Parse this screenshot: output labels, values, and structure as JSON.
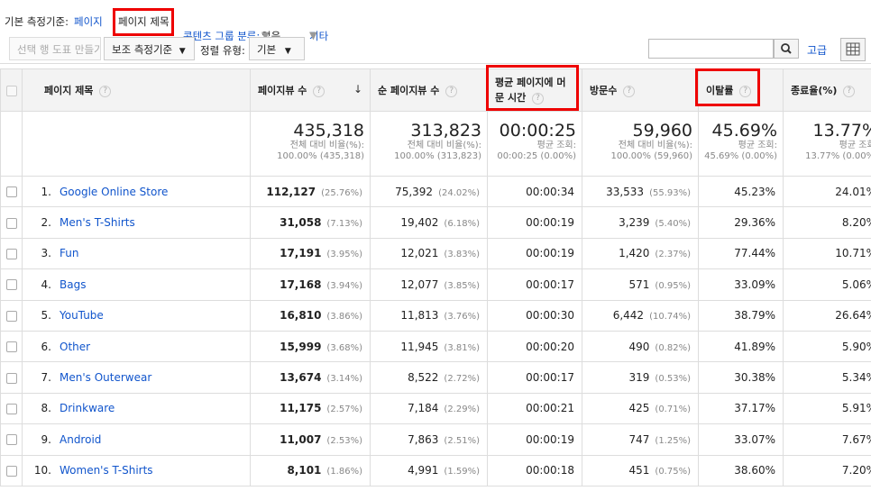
{
  "dimension_bar": {
    "label": "기본 측정기준:",
    "page": "페이지",
    "page_title": "페이지 제목",
    "content_group": "콘텐츠 그룹 분류:",
    "content_group_value": "없음",
    "other": "기타"
  },
  "toolbar": {
    "plot_rows": "선택 행 도표 만들기",
    "secondary_dimension": "보조 측정기준",
    "sort_type_label": "정렬 유형:",
    "sort_type_value": "기본",
    "search_placeholder": "",
    "advanced": "고급"
  },
  "columns": {
    "dimension": "페이지 제목",
    "pageviews": "페이지뷰 수",
    "unique_pageviews": "순 페이지뷰 수",
    "avg_time_line1": "평균 페이지에 머",
    "avg_time_line2": "문 시간",
    "entrances": "방문수",
    "bounce_rate": "이탈률",
    "exit_pct": "종료율(%)"
  },
  "summary": {
    "pageviews": {
      "value": "435,318",
      "sub1": "전체 대비 비율(%):",
      "sub2": "100.00% (435,318)"
    },
    "unique_pageviews": {
      "value": "313,823",
      "sub1": "전체 대비 비율(%):",
      "sub2": "100.00% (313,823)"
    },
    "avg_time": {
      "value": "00:00:25",
      "sub1": "평균 조회:",
      "sub2": "00:00:25 (0.00%)"
    },
    "entrances": {
      "value": "59,960",
      "sub1": "전체 대비 비율(%):",
      "sub2": "100.00% (59,960)"
    },
    "bounce_rate": {
      "value": "45.69%",
      "sub1": "평균 조회:",
      "sub2": "45.69% (0.00%)"
    },
    "exit_pct": {
      "value": "13.77%",
      "sub1": "평균 조회:",
      "sub2": "13.77% (0.00%)"
    }
  },
  "rows": [
    {
      "idx": "1.",
      "title": "Google Online Store",
      "pv": "112,127",
      "pv_pct": "(25.76%)",
      "upv": "75,392",
      "upv_pct": "(24.02%)",
      "time": "00:00:34",
      "ent": "33,533",
      "ent_pct": "(55.93%)",
      "bounce": "45.23%",
      "exit": "24.01%"
    },
    {
      "idx": "2.",
      "title": "Men's T-Shirts",
      "pv": "31,058",
      "pv_pct": "(7.13%)",
      "upv": "19,402",
      "upv_pct": "(6.18%)",
      "time": "00:00:19",
      "ent": "3,239",
      "ent_pct": "(5.40%)",
      "bounce": "29.36%",
      "exit": "8.20%"
    },
    {
      "idx": "3.",
      "title": "Fun",
      "pv": "17,191",
      "pv_pct": "(3.95%)",
      "upv": "12,021",
      "upv_pct": "(3.83%)",
      "time": "00:00:19",
      "ent": "1,420",
      "ent_pct": "(2.37%)",
      "bounce": "77.44%",
      "exit": "10.71%"
    },
    {
      "idx": "4.",
      "title": "Bags",
      "pv": "17,168",
      "pv_pct": "(3.94%)",
      "upv": "12,077",
      "upv_pct": "(3.85%)",
      "time": "00:00:17",
      "ent": "571",
      "ent_pct": "(0.95%)",
      "bounce": "33.09%",
      "exit": "5.06%"
    },
    {
      "idx": "5.",
      "title": "YouTube",
      "pv": "16,810",
      "pv_pct": "(3.86%)",
      "upv": "11,813",
      "upv_pct": "(3.76%)",
      "time": "00:00:30",
      "ent": "6,442",
      "ent_pct": "(10.74%)",
      "bounce": "38.79%",
      "exit": "26.64%"
    },
    {
      "idx": "6.",
      "title": "Other",
      "pv": "15,999",
      "pv_pct": "(3.68%)",
      "upv": "11,945",
      "upv_pct": "(3.81%)",
      "time": "00:00:20",
      "ent": "490",
      "ent_pct": "(0.82%)",
      "bounce": "41.89%",
      "exit": "5.90%"
    },
    {
      "idx": "7.",
      "title": "Men's Outerwear",
      "pv": "13,674",
      "pv_pct": "(3.14%)",
      "upv": "8,522",
      "upv_pct": "(2.72%)",
      "time": "00:00:17",
      "ent": "319",
      "ent_pct": "(0.53%)",
      "bounce": "30.38%",
      "exit": "5.34%"
    },
    {
      "idx": "8.",
      "title": "Drinkware",
      "pv": "11,175",
      "pv_pct": "(2.57%)",
      "upv": "7,184",
      "upv_pct": "(2.29%)",
      "time": "00:00:21",
      "ent": "425",
      "ent_pct": "(0.71%)",
      "bounce": "37.17%",
      "exit": "5.91%"
    },
    {
      "idx": "9.",
      "title": "Android",
      "pv": "11,007",
      "pv_pct": "(2.53%)",
      "upv": "7,863",
      "upv_pct": "(2.51%)",
      "time": "00:00:19",
      "ent": "747",
      "ent_pct": "(1.25%)",
      "bounce": "33.07%",
      "exit": "7.67%"
    },
    {
      "idx": "10.",
      "title": "Women's T-Shirts",
      "pv": "8,101",
      "pv_pct": "(1.86%)",
      "upv": "4,991",
      "upv_pct": "(1.59%)",
      "time": "00:00:18",
      "ent": "451",
      "ent_pct": "(0.75%)",
      "bounce": "38.60%",
      "exit": "7.20%"
    }
  ],
  "colors": {
    "link": "#1155cc",
    "highlight_box": "#e00000",
    "header_bg": "#f3f3f3"
  },
  "icons": {
    "help": "question-circle-icon",
    "search": "search-icon",
    "grid": "grid-view-icon",
    "sort": "arrow-down-icon"
  }
}
